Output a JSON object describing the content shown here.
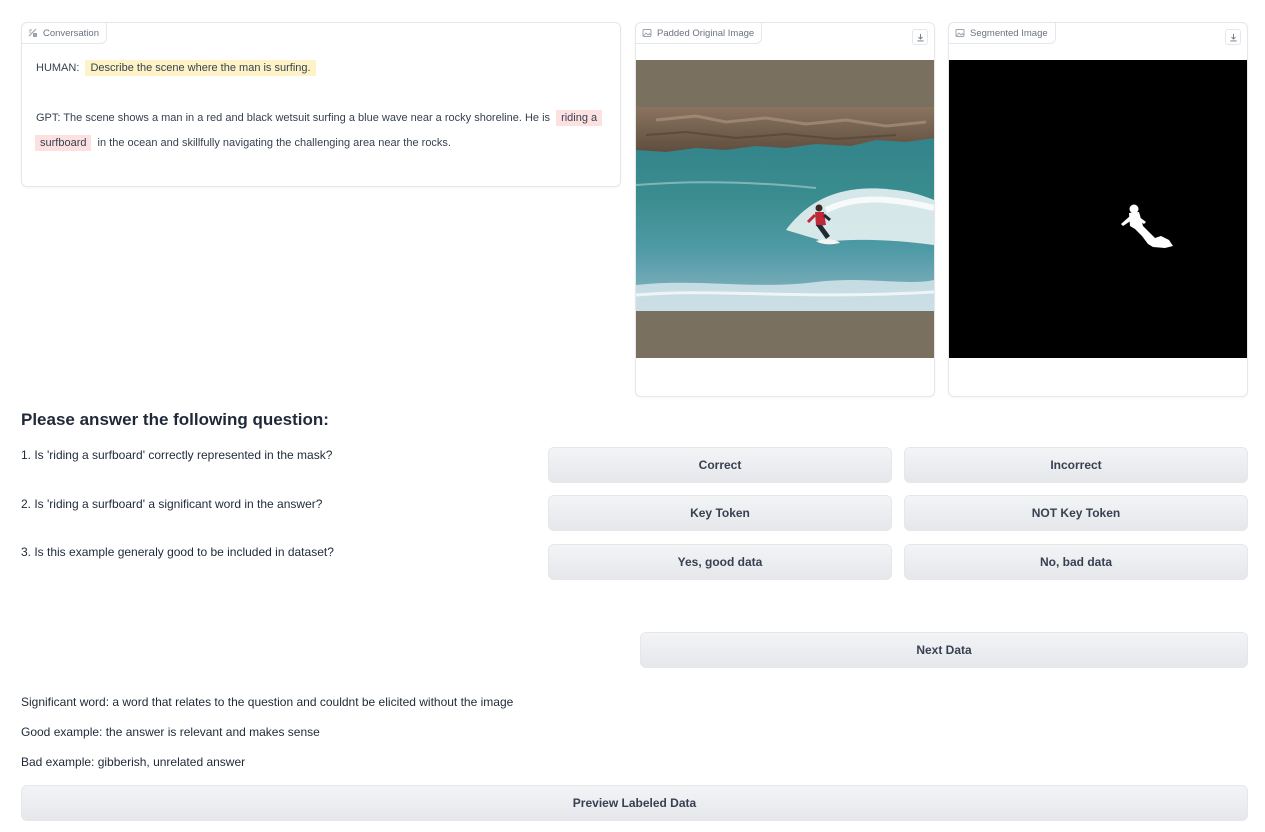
{
  "conversation": {
    "label": "Conversation",
    "human_prefix": "HUMAN:",
    "human_text": "Describe the scene where the man is surfing.",
    "gpt_prefix": "GPT:",
    "gpt_text_before": "The scene shows a man in a red and black wetsuit surfing a blue wave near a rocky shoreline. He is",
    "gpt_highlight": "riding a surfboard",
    "gpt_text_after": "in the ocean and skillfully navigating the challenging area near the rocks."
  },
  "original_image": {
    "label": "Padded Original Image",
    "icon": "image-icon"
  },
  "segmented_image": {
    "label": "Segmented Image",
    "icon": "image-icon"
  },
  "questions": {
    "heading": "Please answer the following question:",
    "q1": {
      "text": "1. Is 'riding a surfboard' correctly represented in the mask?",
      "option_a": "Correct",
      "option_b": "Incorrect"
    },
    "q2": {
      "text": "2. Is 'riding a surfboard' a significant word in the answer?",
      "option_a": "Key Token",
      "option_b": "NOT Key Token"
    },
    "q3": {
      "text": "3. Is this example generaly good to be included in dataset?",
      "option_a": "Yes, good data",
      "option_b": "No, bad data"
    }
  },
  "next_button": "Next Data",
  "notes": {
    "significant": "Significant word: a word that relates to the question and couldnt be elicited without the image",
    "good": "Good example: the answer is relevant and makes sense",
    "bad": "Bad example: gibberish, unrelated answer"
  },
  "preview_button": "Preview Labeled Data",
  "colors": {
    "human_highlight": "#fef3c7",
    "gpt_highlight": "#fde0e0",
    "padding": "#7a7060"
  }
}
